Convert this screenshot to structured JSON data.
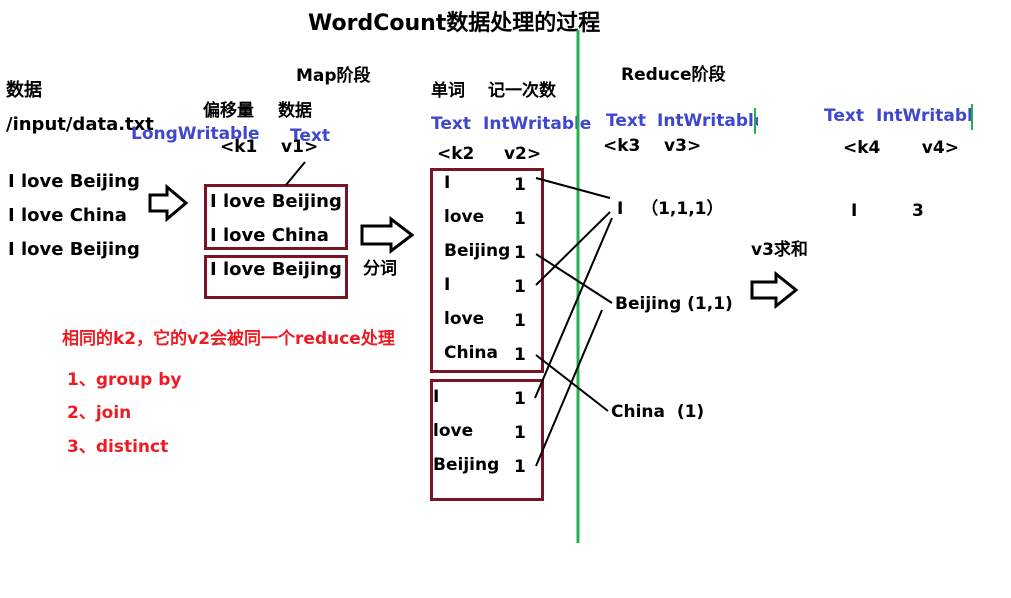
{
  "title": "WordCount数据处理的过程",
  "input": {
    "heading": "数据",
    "path": "/input/data.txt",
    "lines": [
      "I love Beijing",
      "I love China",
      "I love Beijing"
    ]
  },
  "map_input": {
    "stage": "Map阶段",
    "offset_label": "偏移量",
    "data_label": "数据",
    "type_key": "LongWritable",
    "type_value": "Text",
    "kv": "<k1    v1>",
    "split_1": [
      "I love Beijing",
      "I love China"
    ],
    "split_2": [
      "I love Beijing"
    ],
    "split_word": "分词"
  },
  "map_output": {
    "word_label": "单词",
    "count_label": "记一次数",
    "type_key": "Text",
    "type_value": "IntWritable",
    "kv": "<k2     v2>",
    "group1": [
      {
        "word": "I",
        "count": "1"
      },
      {
        "word": "love",
        "count": "1"
      },
      {
        "word": "Beijing",
        "count": "1"
      },
      {
        "word": "I",
        "count": "1"
      },
      {
        "word": "love",
        "count": "1"
      },
      {
        "word": "China",
        "count": "1"
      }
    ],
    "group2": [
      {
        "word": "I",
        "count": "1"
      },
      {
        "word": "love",
        "count": "1"
      },
      {
        "word": "Beijing",
        "count": "1"
      }
    ]
  },
  "reduce_input": {
    "stage": "Reduce阶段",
    "type_key": "Text",
    "type_value": "IntWritable",
    "kv": "<k3    v3>",
    "groups": [
      "I   （1,1,1）",
      "Beijing (1,1)",
      "China  (1)"
    ],
    "sum_label": "v3求和"
  },
  "reduce_output": {
    "type_key": "Text",
    "type_value": "IntWritable",
    "kv": "<k4       v4>",
    "key": "I",
    "value": "3"
  },
  "notes": {
    "heading": "相同的k2，它的v2会被同一个reduce处理",
    "items": [
      "1、group by",
      "2、join",
      "3、distinct"
    ]
  },
  "colors": {
    "blue": "#3f47cc",
    "red": "#ed1c24",
    "box": "#7a1424",
    "divider": "#22b14c"
  }
}
